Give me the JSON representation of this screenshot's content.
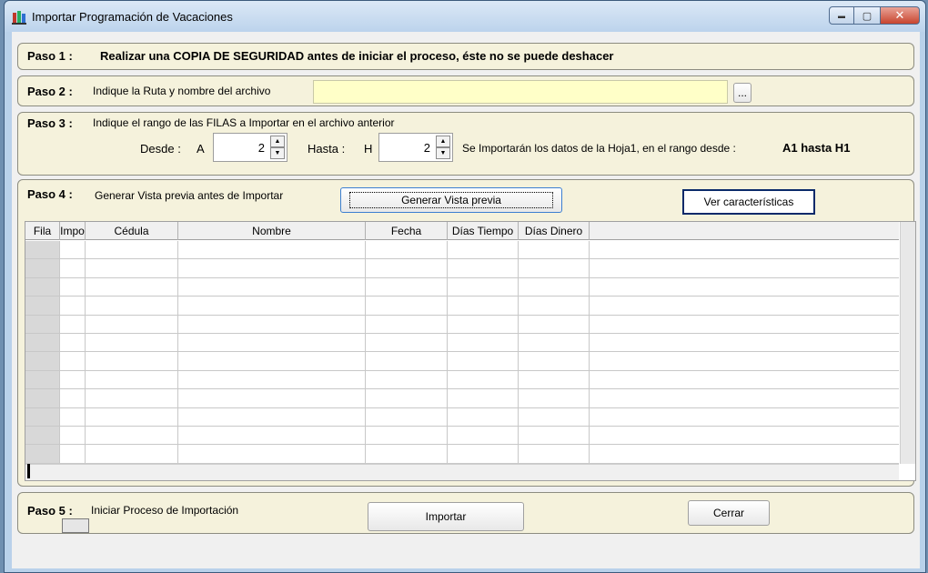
{
  "window": {
    "title": "Importar Programación de Vacaciones",
    "controls": {
      "minimize": "▬",
      "maximize": "▢",
      "close": "✕"
    }
  },
  "paso1": {
    "label": "Paso 1 :",
    "text": "Realizar una COPIA DE SEGURIDAD antes de iniciar el proceso, éste no se puede deshacer"
  },
  "paso2": {
    "label": "Paso 2 :",
    "text": "Indique la Ruta y nombre del archivo",
    "path_value": "",
    "browse_label": "..."
  },
  "paso3": {
    "label": "Paso 3 :",
    "text": "Indique el rango de las FILAS a Importar en el archivo anterior",
    "desde_label": "Desde :",
    "desde_col": "A",
    "desde_value": "2",
    "hasta_label": "Hasta :",
    "hasta_col": "H",
    "hasta_value": "2",
    "summary_text": "Se Importarán los datos de la Hoja1,  en el rango desde :",
    "summary_range": "A1 hasta H1"
  },
  "paso4": {
    "label": "Paso 4 :",
    "text": "Generar Vista previa antes de Importar",
    "preview_button": "Generar Vista previa",
    "features_button": "Ver características"
  },
  "grid": {
    "columns": [
      "Fila",
      "Impo",
      "Cédula",
      "Nombre",
      "Fecha",
      "Días Tiempo",
      "Días Dinero"
    ],
    "row_count": 12
  },
  "paso5": {
    "label": "Paso 5 :",
    "text": "Iniciar Proceso de Importación",
    "import_button": "Importar",
    "close_button": "Cerrar"
  }
}
